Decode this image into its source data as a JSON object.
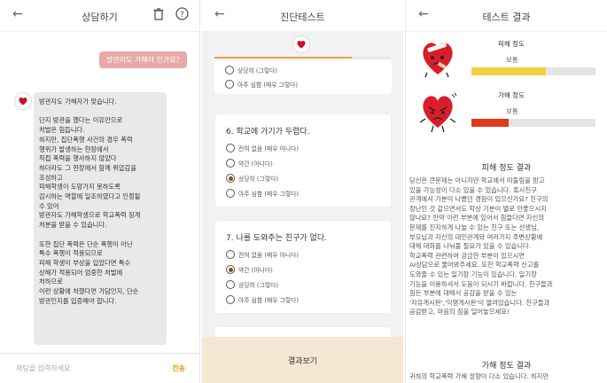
{
  "chat": {
    "title": "상담하기",
    "user_message": "방관자도 가해자 인가요?",
    "bot_reply": "방관자도 가해자가 맞습니다.\n\n단지 방관을 했다는 이유만으로\n처벌은 힘듭니다.\n하지만, 집단폭행 사건의 경우 폭력\n행위가 발생하는 현장에서\n직접 폭력을 행사하지 않았다\n하더라도 그 현장에서 함께 위압감을\n조성하고\n피해학생이 도망가지 못하도록\n감시하는 역할에 일조하였다고 인정될\n수 있어\n방관자도 가해학생으로 학교폭력 징계\n처분을 받을 수 있습니다.\n\n또한 집단 폭력은 단순 폭행이 아닌\n특수 폭행이 적용되므로\n피해 학생이 부상을 입었다면 특수\n상해가 적용되어 엄중한 처벌에\n처하므로\n이런 상황에 처했다면 가담인지, 단순\n방관인지를 입증해야 합니다.",
    "input_placeholder": "채팅을 입력하세요",
    "send_label": "전송"
  },
  "test": {
    "title": "진단테스트",
    "progress": 0.78,
    "top_options": [
      "상당히 (그렇다)",
      "아주 심함 (매우 그렇다)"
    ],
    "questions": [
      {
        "title": "6. 학교에 가기가 두렵다.",
        "options": [
          "전혀 없음 (매우 아니다)",
          "약간 (아니다)",
          "상당히 (그렇다)",
          "아주 심함 (매우 그렇다)"
        ],
        "selected": 2
      },
      {
        "title": "7. 나를 도와주는 친구가 없다.",
        "options": [
          "전혀 없음 (매우 아니다)",
          "약간 (아니다)",
          "상당히 (그렇다)",
          "아주 심함 (매우 그렇다)"
        ],
        "selected": 1
      }
    ],
    "result_button": "결과보기"
  },
  "result": {
    "title": "테스트 결과",
    "victim": {
      "label": "피해 정도",
      "level_text": "보통",
      "value": 0.6,
      "color": "#f2d03b"
    },
    "offender": {
      "label": "가해 정도",
      "level_text": "보통",
      "value": 0.3,
      "color": "#e0391b"
    },
    "victim_section_title": "피해 정도 결과",
    "victim_text": "당신은 큰문제는 아니지만 학교에서 따돌림을 받고\n있을 가능성이 다소 있을 수 있습니다. 혹시친구\n관계에서 기분이 나빴던 경험이 있으신가요? 친구의\n장난인 것 같으면서도 막상 기분이 별로 안좋으시지\n않나요? 만약 이런 부분에 있어서 힘들다면 자신의\n문제를 진지하게 나눌 수 있는 친구 또는 선생님,\n부모님과 자신의 대인관계와 여러가지 주변상황에\n대해 대화를 나눠볼 필요가 있을 수 있습니다.\n학교폭력 관련하여 궁금한 부분이 있으시면\nAI상담으로 물어봐주세요. 또한 학교폭력 신고를\n도와줄 수 있는 일기장 기능이 있습니다. 일기장\n기능을 이용하셔서 도움이 되시기 바랍니다. 친구들과\n힘든 부분에 대해서 공감을 받을 수 있는\n'자유게시판','익명게시판'이 열려있습니다. 친구들과\n공감받고, 마음의 짐을 덜어놓으세요!",
    "offender_section_title": "가해 정도 결과",
    "offender_text": "귀하의 학교폭력 가해 성향이 다소 있습니다. 하지만"
  }
}
